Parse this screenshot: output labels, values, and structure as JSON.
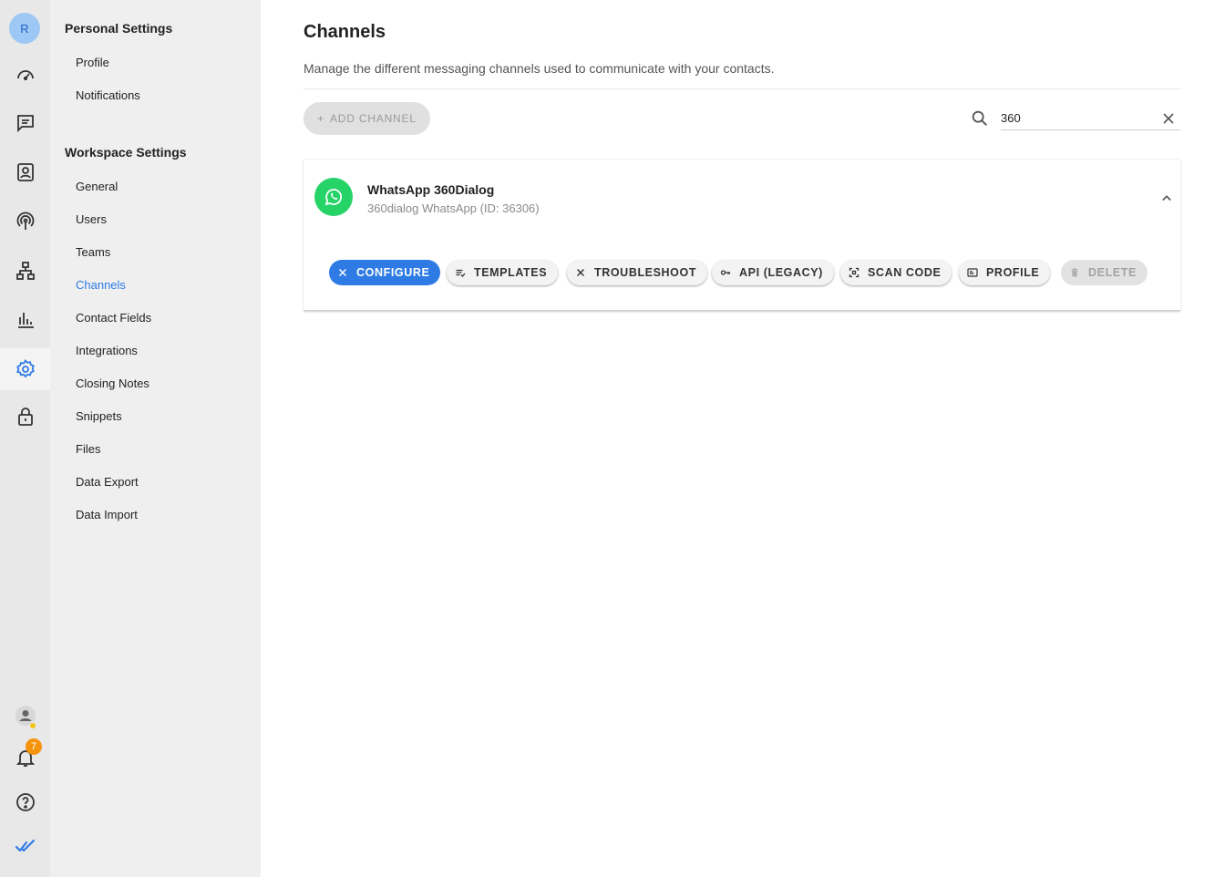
{
  "rail": {
    "avatar_initial": "R",
    "notification_count": "7",
    "icons": [
      "dashboard-icon",
      "messages-icon",
      "contacts-icon",
      "broadcast-icon",
      "workflows-icon",
      "reports-icon",
      "settings-icon",
      "lock-icon",
      "user-status-icon",
      "bell-icon",
      "help-icon",
      "app-logo-icon"
    ],
    "accent": "#2f7be5"
  },
  "settings": {
    "personal_title": "Personal Settings",
    "personal_items": [
      "Profile",
      "Notifications"
    ],
    "workspace_title": "Workspace Settings",
    "workspace_items": [
      "General",
      "Users",
      "Teams",
      "Channels",
      "Contact Fields",
      "Integrations",
      "Closing Notes",
      "Snippets",
      "Files",
      "Data Export",
      "Data Import"
    ],
    "active_item": "Channels"
  },
  "main": {
    "title": "Channels",
    "subtitle": "Manage the different messaging channels used to communicate with your contacts.",
    "add_channel_label": "ADD CHANNEL",
    "add_channel_icon": "+",
    "search": {
      "value": "360",
      "placeholder": ""
    },
    "channel": {
      "name": "WhatsApp 360Dialog",
      "description": "360dialog WhatsApp (ID: 36306)",
      "brand_color": "#25d366",
      "actions": [
        {
          "label": "CONFIGURE",
          "icon": "configure-icon"
        },
        {
          "label": "TEMPLATES",
          "icon": "templates-icon"
        },
        {
          "label": "TROUBLESHOOT",
          "icon": "troubleshoot-icon"
        },
        {
          "label": "API (LEGACY)",
          "icon": "key-icon"
        },
        {
          "label": "SCAN CODE",
          "icon": "scan-icon"
        },
        {
          "label": "PROFILE",
          "icon": "profile-card-icon"
        },
        {
          "label": "DELETE",
          "icon": "trash-icon"
        }
      ]
    }
  }
}
